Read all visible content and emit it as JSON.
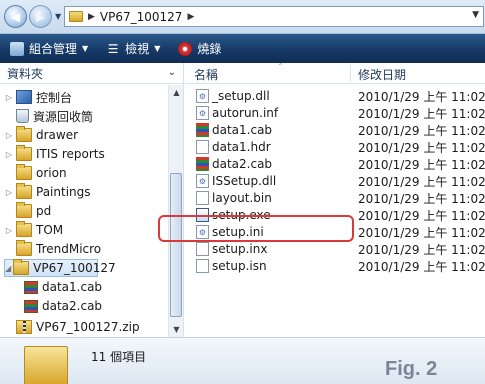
{
  "address": {
    "path": "VP67_100127",
    "back_icon": "back-arrow-icon",
    "forward_icon": "forward-arrow-icon"
  },
  "toolbar": {
    "organize": "組合管理",
    "views": "檢視",
    "burn": "燒錄"
  },
  "left_pane": {
    "header": "資料夾",
    "items": [
      {
        "label": "控制台",
        "icon": "control-panel-icon"
      },
      {
        "label": "資源回收筒",
        "icon": "recycle-bin-icon"
      },
      {
        "label": "drawer",
        "icon": "folder-icon"
      },
      {
        "label": "ITIS reports",
        "icon": "folder-icon"
      },
      {
        "label": "orion",
        "icon": "folder-icon"
      },
      {
        "label": "Paintings",
        "icon": "folder-icon"
      },
      {
        "label": "pd",
        "icon": "folder-icon"
      },
      {
        "label": "TOM",
        "icon": "folder-icon"
      },
      {
        "label": "TrendMicro",
        "icon": "folder-icon"
      },
      {
        "label": "VP67_100127",
        "icon": "folder-icon"
      },
      {
        "label": "data1.cab",
        "icon": "cab-icon"
      },
      {
        "label": "data2.cab",
        "icon": "cab-icon"
      },
      {
        "label": "VP67_100127.zip",
        "icon": "zip-icon"
      }
    ]
  },
  "file_list": {
    "col_name": "名稱",
    "col_date": "修改日期",
    "files": [
      {
        "name": "_setup.dll",
        "date": "2010/1/29 上午 11:02"
      },
      {
        "name": "autorun.inf",
        "date": "2010/1/29 上午 11:02"
      },
      {
        "name": "data1.cab",
        "date": "2010/1/29 上午 11:02"
      },
      {
        "name": "data1.hdr",
        "date": "2010/1/29 上午 11:02"
      },
      {
        "name": "data2.cab",
        "date": "2010/1/29 上午 11:02"
      },
      {
        "name": "ISSetup.dll",
        "date": "2010/1/29 上午 11:02"
      },
      {
        "name": "layout.bin",
        "date": "2010/1/29 上午 11:02"
      },
      {
        "name": "setup.exe",
        "date": "2010/1/29 上午 11:02"
      },
      {
        "name": "setup.ini",
        "date": "2010/1/29 上午 11:02"
      },
      {
        "name": "setup.inx",
        "date": "2010/1/29 上午 11:02"
      },
      {
        "name": "setup.isn",
        "date": "2010/1/29 上午 11:02"
      }
    ]
  },
  "details": {
    "count": "11 個項目"
  },
  "caption": "Fig. 2",
  "colors": {
    "toolbar": "#163a66",
    "highlight": "#d63a3a",
    "selection": "#cfe3f7"
  }
}
